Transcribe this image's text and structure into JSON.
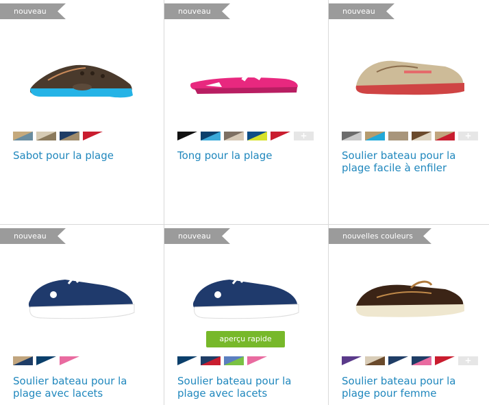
{
  "products": [
    {
      "tag": "nouveau",
      "title": "Sabot pour la plage",
      "shoe": "clog-brown-blue",
      "swatches": [
        [
          "#c5a97c",
          "#6a8da0"
        ],
        [
          "#d6cbb4",
          "#8b7a5c"
        ],
        [
          "#1f3d66",
          "#a08c6c"
        ],
        [
          "#c91d2f",
          "#ffffff"
        ]
      ],
      "more": false
    },
    {
      "tag": "nouveau",
      "title": "Tong pour la plage",
      "shoe": "flipflop-pink",
      "swatches": [
        [
          "#111111",
          "#ffffff"
        ],
        [
          "#0b3f6b",
          "#3aa9d9"
        ],
        [
          "#7d6f62",
          "#d6c8b5"
        ],
        [
          "#0f4e86",
          "#d7e22a"
        ],
        [
          "#c91d2f",
          "#ffffff"
        ]
      ],
      "more": true
    },
    {
      "tag": "nouveau",
      "title": "Soulier bateau pour la plage facile à enfiler",
      "shoe": "slipon-khaki-red",
      "swatches": [
        [
          "#6c6c6c",
          "#c9c9c9"
        ],
        [
          "#b59b6e",
          "#22a9d9"
        ],
        [
          "#a8957b",
          "#a8957b"
        ],
        [
          "#6b4a2c",
          "#ddd3c0"
        ],
        [
          "#c1a57e",
          "#c91d2f"
        ]
      ],
      "more": true
    },
    {
      "tag": "nouveau",
      "title": "Soulier bateau pour la plage avec lacets",
      "shoe": "laceup-navy",
      "swatches": [
        [
          "#c1a57e",
          "#1f3d66"
        ],
        [
          "#0b3f6b",
          "#ffffff"
        ],
        [
          "#e96ba0",
          "#ffffff"
        ]
      ],
      "more": false
    },
    {
      "tag": "nouveau",
      "title": "Soulier bateau pour la plage avec lacets",
      "shoe": "laceup-navy",
      "swatches": [
        [
          "#0b3f6b",
          "#ffffff"
        ],
        [
          "#1f3d66",
          "#c91d2f"
        ],
        [
          "#5b7fc0",
          "#7ac143"
        ],
        [
          "#e96ba0",
          "#ffffff"
        ]
      ],
      "more": false,
      "quickview": "aperçu rapide"
    },
    {
      "tag": "nouvelles couleurs",
      "title": "Soulier bateau pour la plage pour femme",
      "shoe": "boat-brown",
      "swatches": [
        [
          "#5a3a8a",
          "#ffffff"
        ],
        [
          "#d9cdb8",
          "#6a4a2c"
        ],
        [
          "#1f3d66",
          "#ffffff"
        ],
        [
          "#1f3d66",
          "#e96ba0"
        ],
        [
          "#c91d2f",
          "#ffffff"
        ]
      ],
      "more": true
    }
  ]
}
